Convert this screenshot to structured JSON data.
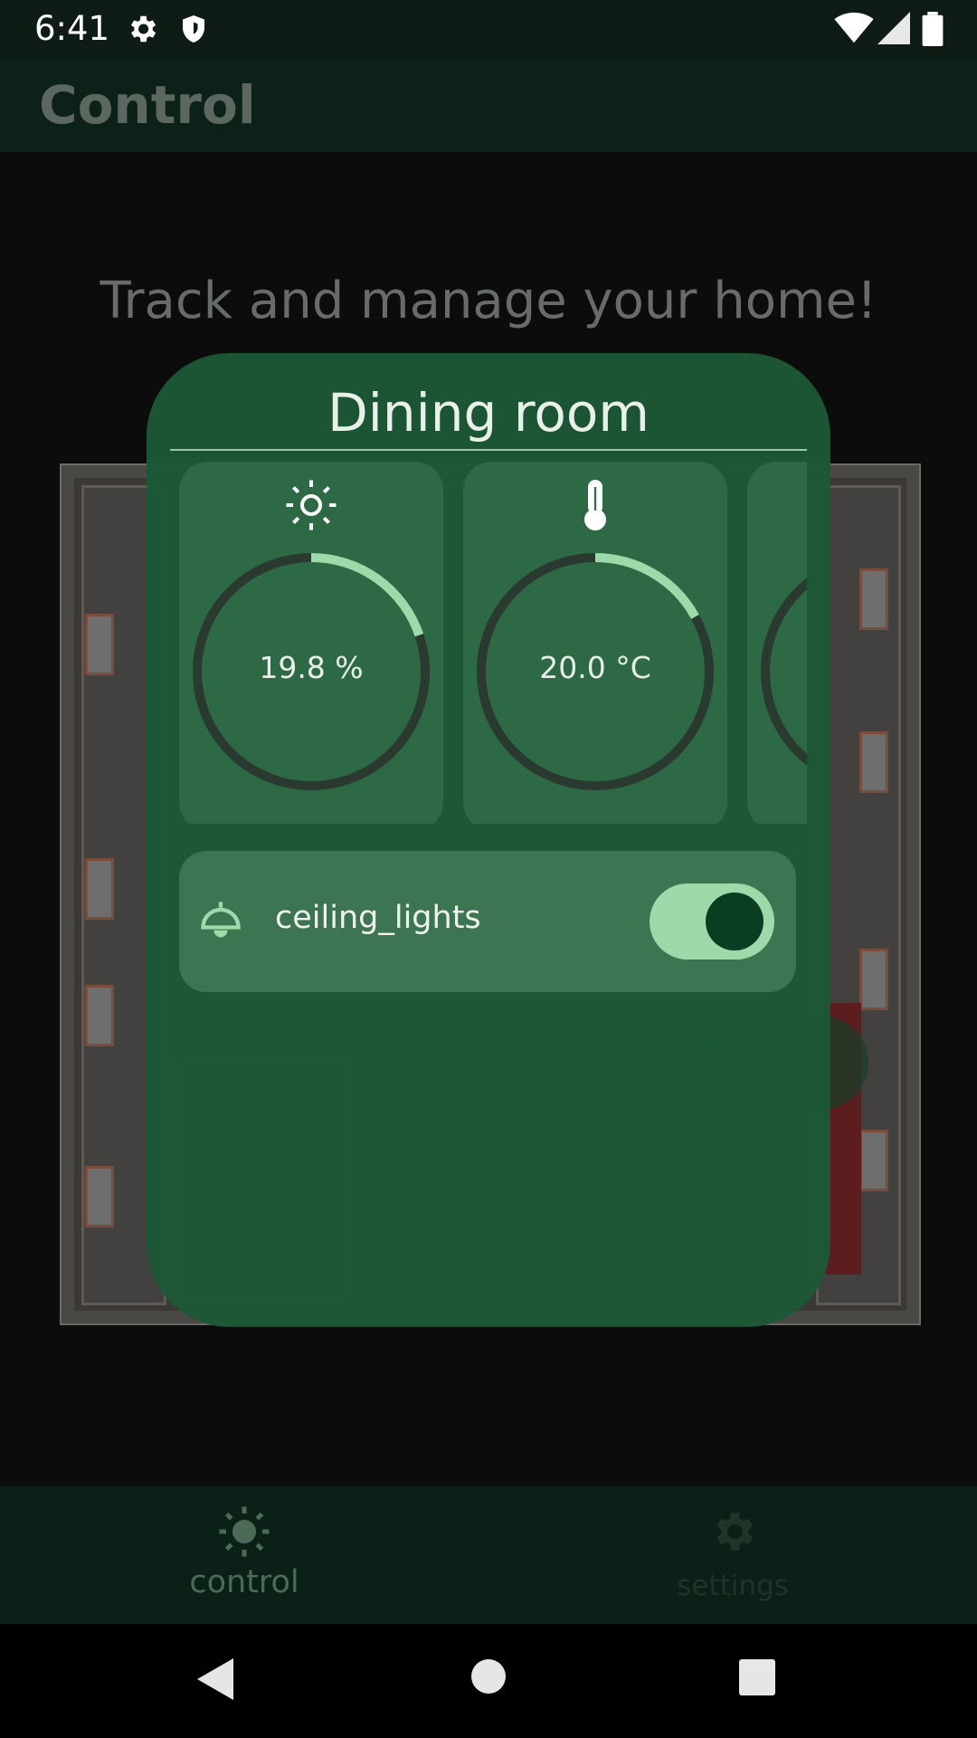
{
  "status_bar": {
    "time": "6:41",
    "icons": [
      "gear-icon",
      "shield-icon",
      "wifi-icon",
      "signal-icon",
      "battery-icon"
    ]
  },
  "app_bar": {
    "title": "Control"
  },
  "main": {
    "tagline": "Track and manage your home!"
  },
  "dialog": {
    "title": "Dining room",
    "sensors": [
      {
        "icon": "sun-icon",
        "value_label": "19.8 %",
        "level": 0.198
      },
      {
        "icon": "thermometer-icon",
        "value_label": "20.0 °C",
        "level": 0.17
      }
    ],
    "device": {
      "icon": "ceiling-lamp-icon",
      "label": "ceiling_lights",
      "on": true
    }
  },
  "bottom_nav": {
    "items": [
      {
        "label": "control",
        "icon": "sun-icon",
        "active": true
      },
      {
        "label": "settings",
        "icon": "gear-icon",
        "active": false
      }
    ]
  },
  "colors": {
    "accent": "#9dd9a9",
    "dialog_bg": "#1c5836",
    "app_bar_bg": "#0c2117",
    "ring_track": "#2b3a30"
  }
}
